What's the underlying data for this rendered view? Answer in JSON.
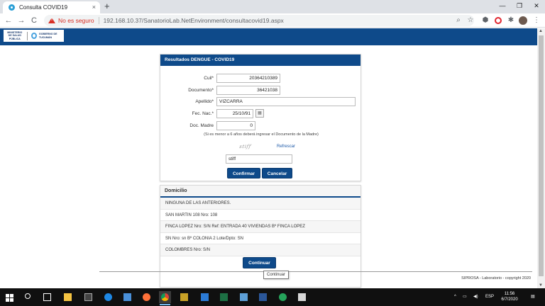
{
  "browser": {
    "tab_title": "Consulta COVID19",
    "tab_close": "×",
    "new_tab": "+",
    "window_controls": {
      "minimize": "—",
      "maximize": "❐",
      "close": "✕"
    },
    "nav": {
      "back": "←",
      "forward": "→",
      "reload": "C"
    },
    "security": "No es seguro",
    "url": "192.168.10.37/SanatorioLab.NetEnvironment/consultacovid19.aspx"
  },
  "header": {
    "logo_ministerio": "MINISTERIO DE SALUD PÚBLICA",
    "logo_gobierno": "GOBIERNO DE TUCUMÁN"
  },
  "form": {
    "title": "Resultados DENGUE - COVID19",
    "cuil_label": "Cuil*",
    "cuil_value": "20364210389",
    "documento_label": "Documento*",
    "documento_value": "36421038",
    "apellido_label": "Apellido*",
    "apellido_value": "VIZCARRA",
    "fecnac_label": "Fec. Nac.*",
    "fecnac_value": "25/10/91",
    "docmadre_label": "Doc. Madre",
    "docmadre_value": "0",
    "note": "(Si es menor a 6 años deberá ingresar el Documento de la Madre)",
    "captcha_text": "stiff",
    "refrescar": "Refrescar",
    "captcha_value": "stiff",
    "confirmar": "Confirmar",
    "cancelar": "Cancelar"
  },
  "domicilio": {
    "title": "Domicilio",
    "items": [
      "NINGUNA DE LAS ANTERIORES.",
      "SAN MARTIN 108 Nro: 108",
      "FINCA LOPEZ Nro: S/N Ref: ENTRADA 40 VIVIENDAS Bº FINCA LOPEZ",
      "SN Nro: sn Bº COLONIA 2 Lote/Dpto: SN",
      "COLOMBRES Nro: S/N"
    ]
  },
  "footer": {
    "continuar": "Continuar",
    "tooltip": "Continuar",
    "copyright": "SIPROSA - Laboratorio - copyright 2020"
  },
  "taskbar": {
    "lang": "ESP",
    "time": "11:56",
    "date": "6/7/2020"
  },
  "colors": {
    "brand": "#0e4a8a",
    "warning": "#d93025",
    "link": "#1e5aa8"
  }
}
